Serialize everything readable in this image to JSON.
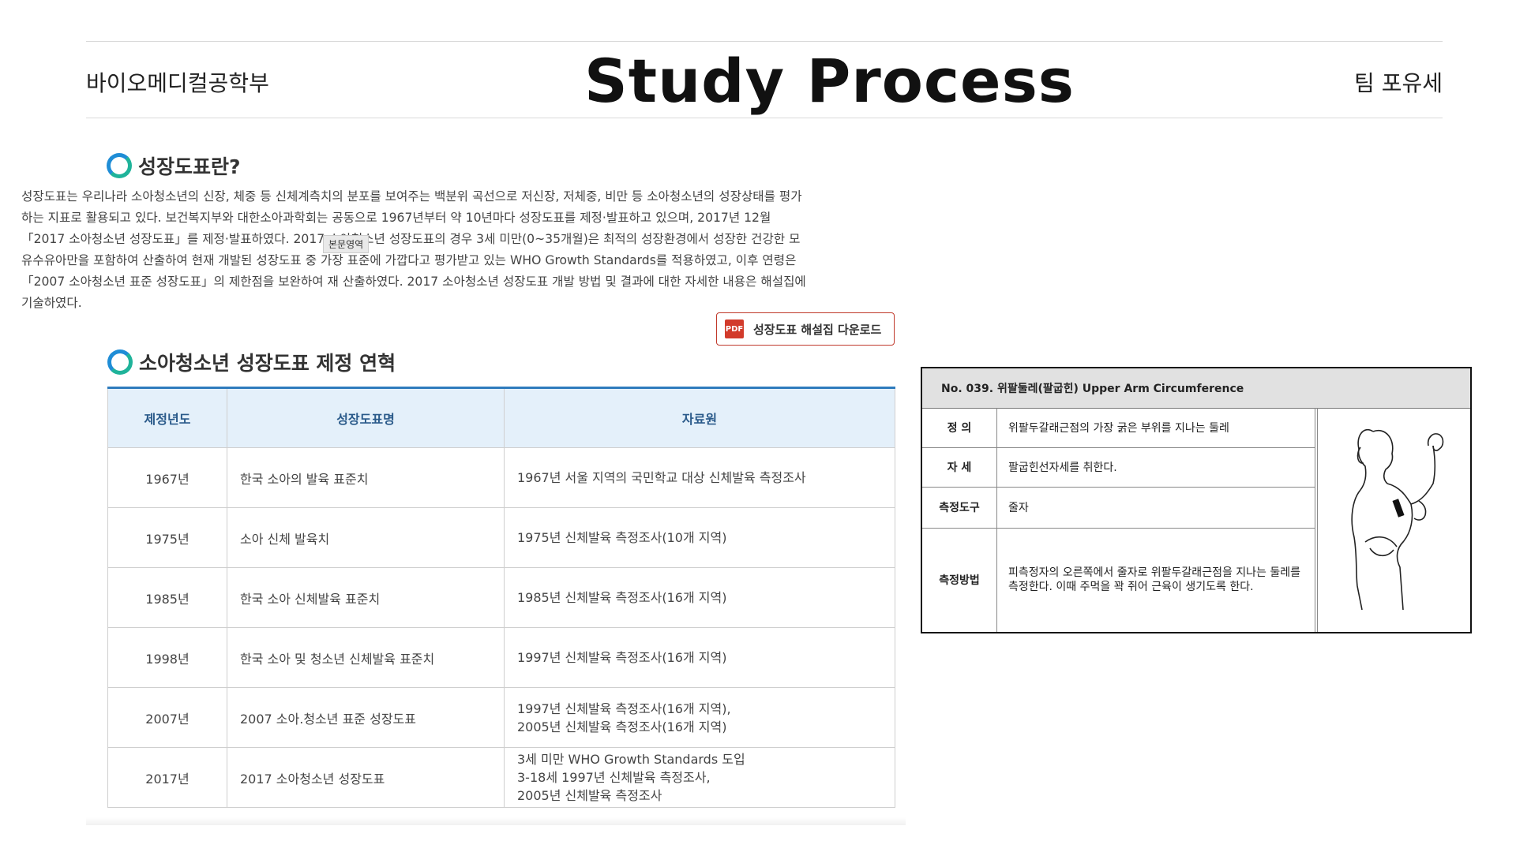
{
  "header": {
    "department": "바이오메디컬공학부",
    "title": "Study Process",
    "team": "팀 포유세"
  },
  "section1": {
    "heading": "성장도표란?",
    "paragraph": "성장도표는 우리나라 소아청소년의 신장, 체중 등 신체계측치의 분포를 보여주는 백분위 곡선으로 저신장, 저체중, 비만 등 소아청소년의 성장상태를 평가하는 지표로 활용되고 있다. 보건복지부와 대한소아과학회는 공동으로 1967년부터 약 10년마다 성장도표를 제정·발표하고 있으며, 2017년 12월 「2017 소아청소년 성장도표」를 제정·발표하였다. 2017 소아청소년 성장도표의 경우 3세 미만(0~35개월)은 최적의 성장환경에서 성장한 건강한 모유수유아만을 포함하여 산출하여 현재 개발된 성장도표 중 가장 표준에 가깝다고 평가받고 있는 WHO Growth Standards를 적용하였고, 이후 연령은 「2007 소아청소년 표준 성장도표」의 제한점을 보완하여 재 산출하였다. 2017 소아청소년 성장도표 개발 방법 및 결과에 대한 자세한 내용은 해설집에 기술하였다.",
    "tooltip": "본문영역",
    "download_label": "성장도표 해설집 다운로드",
    "pdf_icon": "pdf-icon"
  },
  "section2": {
    "heading": "소아청소년 성장도표 제정 연혁",
    "columns": [
      "제정년도",
      "성장도표명",
      "자료원"
    ],
    "rows": [
      [
        "1967년",
        "한국 소아의 발육 표준치",
        "1967년 서울 지역의 국민학교 대상 신체발육 측정조사"
      ],
      [
        "1975년",
        "소아 신체 발육치",
        "1975년 신체발육 측정조사(10개 지역)"
      ],
      [
        "1985년",
        "한국 소아 신체발육 표준치",
        "1985년 신체발육 측정조사(16개 지역)"
      ],
      [
        "1998년",
        "한국 소아 및 청소년 신체발육 표준치",
        "1997년 신체발육 측정조사(16개 지역)"
      ],
      [
        "2007년",
        "2007 소아.청소년 표준 성장도표",
        "1997년 신체발육 측정조사(16개 지역),\n2005년 신체발육 측정조사(16개 지역)"
      ],
      [
        "2017년",
        "2017 소아청소년 성장도표",
        "3세 미만 WHO Growth Standards 도입\n3-18세 1997년 신체발육 측정조사,\n      2005년 신체발육 측정조사"
      ]
    ]
  },
  "card": {
    "title": "No. 039. 위팔둘레(팔굽힌) Upper Arm Circumference",
    "rows": [
      {
        "key": "정 의",
        "value": "위팔두갈래근점의 가장 굵은 부위를 지나는 둘레"
      },
      {
        "key": "자 세",
        "value": "팔굽힌선자세를 취한다."
      },
      {
        "key": "측정도구",
        "value": "줄자"
      },
      {
        "key": "측정방법",
        "value": "피측정자의 오른쪽에서 줄자로 위팔두갈래근점을 지나는 둘레를 측정한다. 이때 주먹을 꽉 쥐어 근육이 생기도록 한다."
      }
    ],
    "figure_icon": "arm-measurement-figure"
  }
}
